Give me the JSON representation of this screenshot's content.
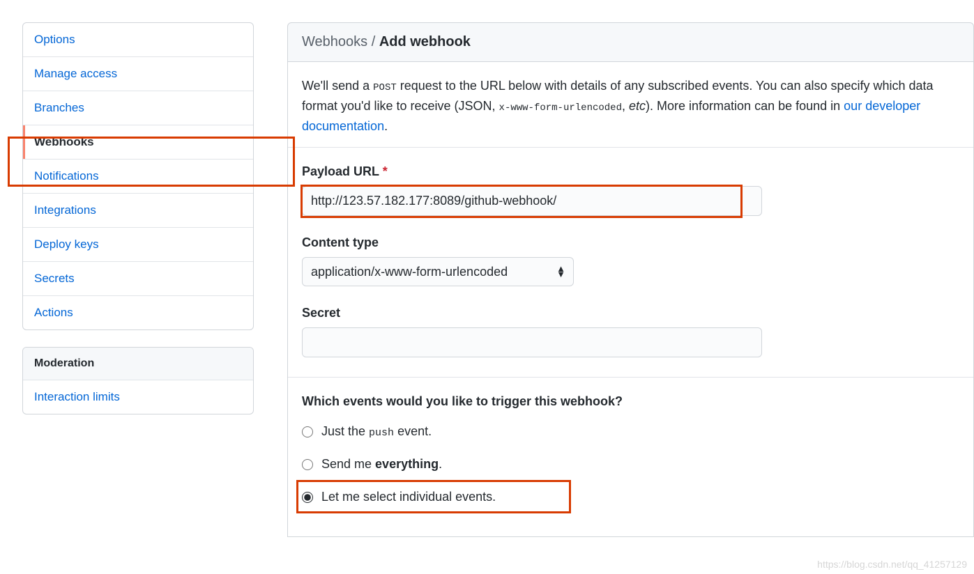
{
  "sidebar": {
    "settings_items": [
      {
        "label": "Options",
        "selected": false
      },
      {
        "label": "Manage access",
        "selected": false
      },
      {
        "label": "Branches",
        "selected": false
      },
      {
        "label": "Webhooks",
        "selected": true
      },
      {
        "label": "Notifications",
        "selected": false
      },
      {
        "label": "Integrations",
        "selected": false
      },
      {
        "label": "Deploy keys",
        "selected": false
      },
      {
        "label": "Secrets",
        "selected": false
      },
      {
        "label": "Actions",
        "selected": false
      }
    ],
    "moderation_header": "Moderation",
    "moderation_items": [
      {
        "label": "Interaction limits"
      }
    ]
  },
  "header": {
    "breadcrumb_parent": "Webhooks",
    "separator": " / ",
    "breadcrumb_current": "Add webhook"
  },
  "intro": {
    "t1": "We'll send a ",
    "code1": "POST",
    "t2": " request to the URL below with details of any subscribed events. You can also specify which data format you'd like to receive (JSON, ",
    "code2": "x-www-form-urlencoded",
    "t3": ", ",
    "em": "etc",
    "t4": "). More information can be found in ",
    "link": "our developer documentation",
    "t5": "."
  },
  "form": {
    "payload_url_label": "Payload URL",
    "required_mark": "*",
    "payload_url_value": "http://123.57.182.177:8089/github-webhook/",
    "content_type_label": "Content type",
    "content_type_value": "application/x-www-form-urlencoded",
    "secret_label": "Secret",
    "secret_value": ""
  },
  "events": {
    "title": "Which events would you like to trigger this webhook?",
    "opt_push_pre": "Just the ",
    "opt_push_code": "push",
    "opt_push_post": " event.",
    "opt_everything_pre": "Send me ",
    "opt_everything_strong": "everything",
    "opt_everything_post": ".",
    "opt_individual": "Let me select individual events.",
    "selected": "individual"
  },
  "watermark": "https://blog.csdn.net/qq_41257129"
}
